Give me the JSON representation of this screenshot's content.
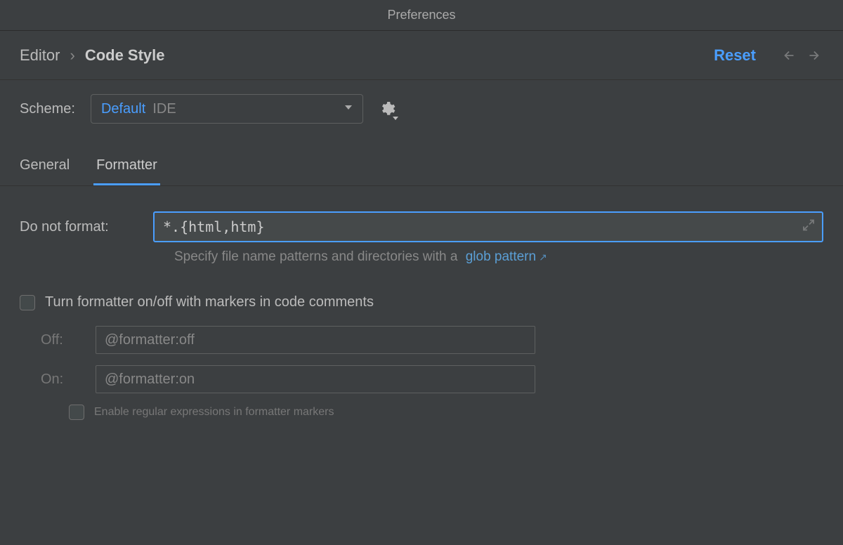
{
  "title": "Preferences",
  "breadcrumb": {
    "editor": "Editor",
    "code_style": "Code Style"
  },
  "reset": "Reset",
  "scheme": {
    "label": "Scheme:",
    "name": "Default",
    "scope": "IDE"
  },
  "tabs": {
    "general": "General",
    "formatter": "Formatter"
  },
  "do_not_format": {
    "label": "Do not format:",
    "value": "*.{html,htm}",
    "hint_prefix": "Specify file name patterns and directories with a",
    "hint_link": "glob pattern",
    "hint_ext": "↗"
  },
  "markers": {
    "toggle": "Turn formatter on/off with markers in code comments",
    "off_label": "Off:",
    "off_value": "@formatter:off",
    "on_label": "On:",
    "on_value": "@formatter:on",
    "regex": "Enable regular expressions in formatter markers"
  }
}
